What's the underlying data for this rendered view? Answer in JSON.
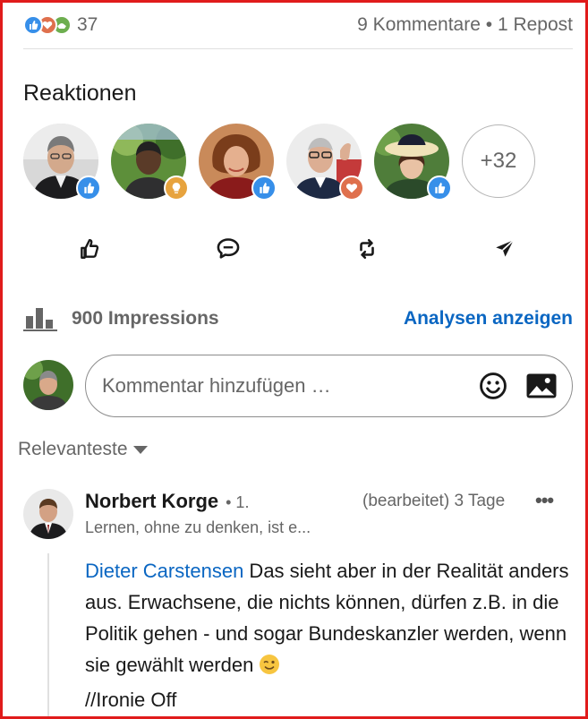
{
  "post_stats": {
    "reaction_count": "37",
    "comments": "9 Kommentare",
    "separator": " • ",
    "reposts": "1 Repost",
    "reaction_types": [
      "like",
      "love",
      "support"
    ]
  },
  "reactions": {
    "title": "Reaktionen",
    "people": [
      {
        "badge": "like"
      },
      {
        "badge": "insightful"
      },
      {
        "badge": "like"
      },
      {
        "badge": "love"
      },
      {
        "badge": "like"
      }
    ],
    "more": "+32"
  },
  "actions": [
    "like-icon",
    "comment-icon",
    "repost-icon",
    "send-icon"
  ],
  "impressions": {
    "text": "900 Impressions",
    "link": "Analysen anzeigen"
  },
  "comment_input": {
    "placeholder": "Kommentar hinzufügen …",
    "icons": [
      "emoji-icon",
      "image-icon"
    ]
  },
  "sort": {
    "label": "Relevanteste"
  },
  "comment": {
    "author": "Norbert Korge",
    "degree": "• 1.",
    "meta": "(bearbeitet) 3 Tage",
    "more": "•••",
    "headline": "Lernen, ohne zu denken, ist e...",
    "mention": "Dieter Carstensen",
    "text": " Das sieht aber in der Realität anders aus. Erwachsene, die nichts können, dürfen z.B. in die Politik gehen - und sogar Bundeskanzler werden, wenn sie gewählt werden ",
    "ending": "//Ironie Off"
  },
  "colors": {
    "accent": "#0a66c2",
    "like": "#378fe9",
    "love": "#df704d",
    "support": "#6dae4f",
    "insight": "#e7a33e",
    "frame": "#e01b1b"
  }
}
